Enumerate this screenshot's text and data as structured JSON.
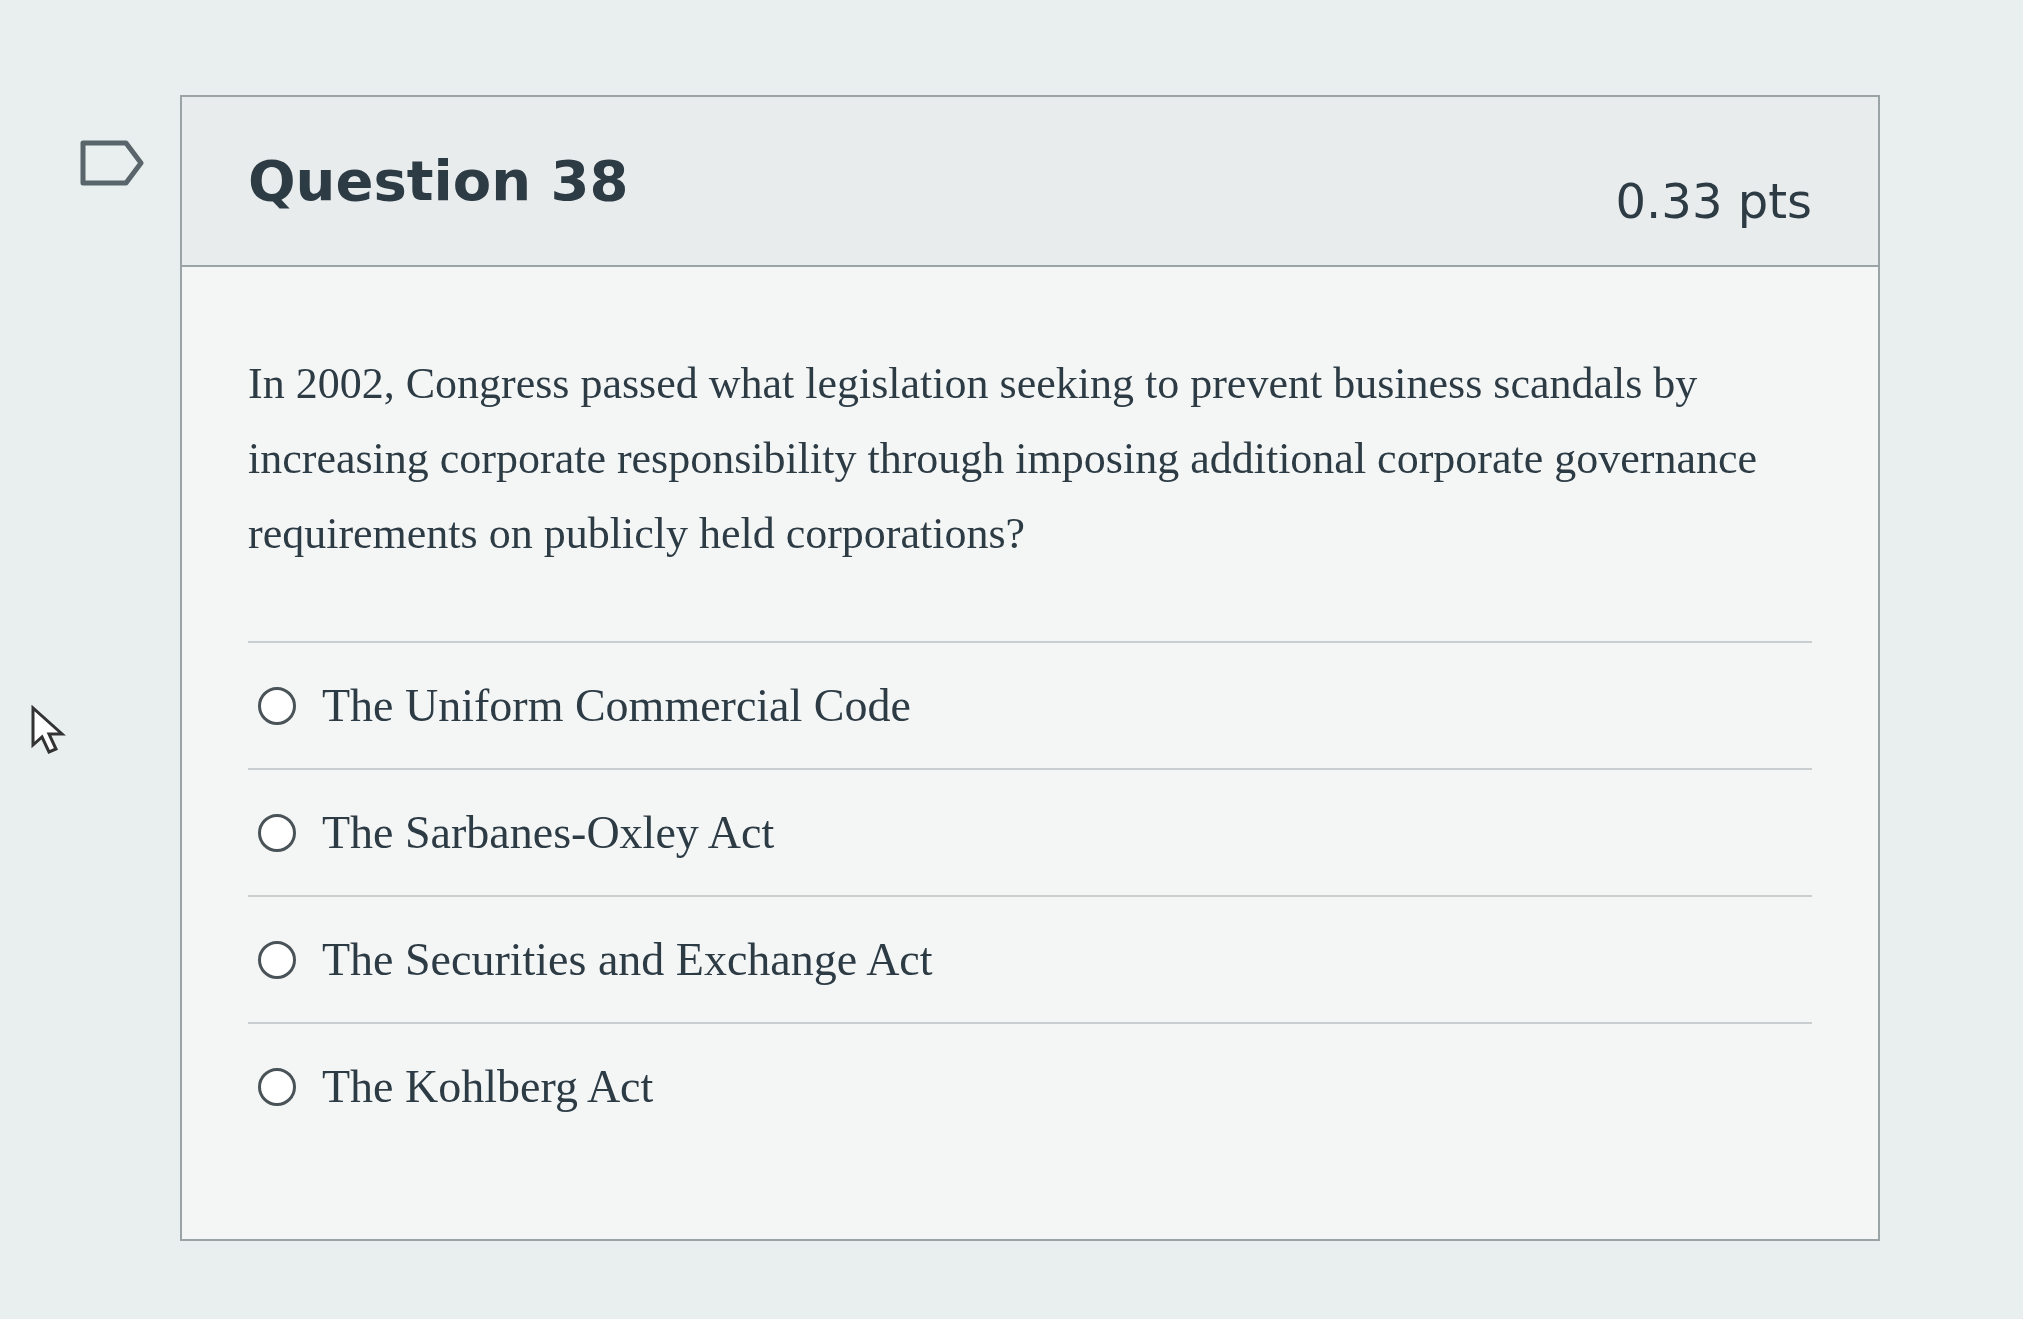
{
  "question": {
    "flagged": false,
    "title": "Question 38",
    "points": "0.33 pts",
    "text": "In 2002, Congress passed what legislation seeking to prevent business scandals by increasing corporate responsibility through imposing additional corporate governance requirements on publicly held corporations?",
    "answers": [
      {
        "label": "The Uniform Commercial Code",
        "selected": false
      },
      {
        "label": "The Sarbanes-Oxley Act",
        "selected": false
      },
      {
        "label": "The Securities and Exchange Act",
        "selected": false
      },
      {
        "label": "The Kohlberg Act",
        "selected": false
      }
    ]
  }
}
